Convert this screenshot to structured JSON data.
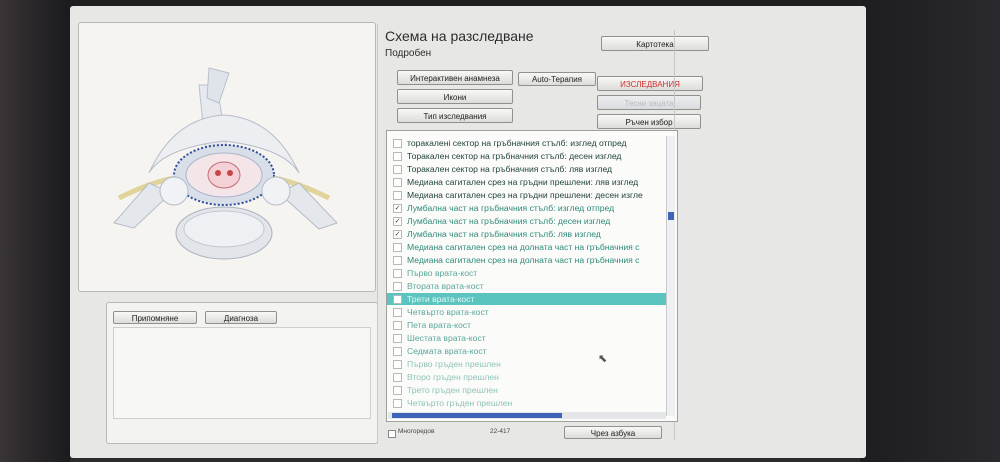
{
  "header": {
    "title": "Схема на разследване",
    "subtitle": "Подробен"
  },
  "toolbar": {
    "card": "Картотека",
    "interactive_anamnesis": "Интерактивен анамнеза",
    "auto_therapy": "Auto-Терапия",
    "examinations": "ИЗСЛЕДВАНИЯ",
    "icons": "Икони",
    "disabled_button": "Тесни зацата",
    "exam_type": "Тип изследвания",
    "manual_select": "Ръчен избор"
  },
  "notes": {
    "tab_reminder": "Припомняне",
    "tab_diagnosis": "Диагноза"
  },
  "list": {
    "items": [
      {
        "label": "торакалені сектор на гръбначния стълб: изглед отпред",
        "checked": false,
        "style": "dark"
      },
      {
        "label": "Торакален сектор на гръбначния стълб: десен изглед",
        "checked": false,
        "style": "dark"
      },
      {
        "label": "Торакален сектор на гръбначния стълб: ляв изглед",
        "checked": false,
        "style": "dark"
      },
      {
        "label": "Медиана сагитален срез на гръдни прешлени: ляв изглед",
        "checked": false,
        "style": "dark"
      },
      {
        "label": "Медиана сагитален срез на гръдни прешлени: десен изгле",
        "checked": false,
        "style": "dark"
      },
      {
        "label": "Лумбална част на гръбначния стълб: изглед отпред",
        "checked": true,
        "style": "normal"
      },
      {
        "label": "Лумбална част на гръбначния стълб: десен изглед",
        "checked": true,
        "style": "normal"
      },
      {
        "label": "Лумбална част на гръбначния стълб: ляв изглед",
        "checked": true,
        "style": "normal"
      },
      {
        "label": "Медиана сагитален срез на долната част на гръбначния с",
        "checked": false,
        "style": "normal"
      },
      {
        "label": "Медиана сагитален срез на долната част на гръбначния с",
        "checked": false,
        "style": "normal"
      },
      {
        "label": "Първо врата-кост",
        "checked": false,
        "style": "light"
      },
      {
        "label": "Втората врата-кост",
        "checked": false,
        "style": "light"
      },
      {
        "label": "Трети врата-кост",
        "checked": false,
        "style": "selected"
      },
      {
        "label": "Четвърто врата-кост",
        "checked": false,
        "style": "light"
      },
      {
        "label": "Пета врата-кост",
        "checked": false,
        "style": "light"
      },
      {
        "label": "Шестата врата-кост",
        "checked": false,
        "style": "light"
      },
      {
        "label": "Седмата врата-кост",
        "checked": false,
        "style": "light"
      },
      {
        "label": "Първо гръден прешлен",
        "checked": false,
        "style": "faded"
      },
      {
        "label": "Второ гръден прешлен",
        "checked": false,
        "style": "faded"
      },
      {
        "label": "Трето гръден прешлен",
        "checked": false,
        "style": "faded"
      },
      {
        "label": "Четвърто гръден прешлен",
        "checked": false,
        "style": "faded"
      }
    ]
  },
  "footer": {
    "multiple": "Многоредов",
    "count": "22-417",
    "alphabet": "Чрез азбука"
  }
}
